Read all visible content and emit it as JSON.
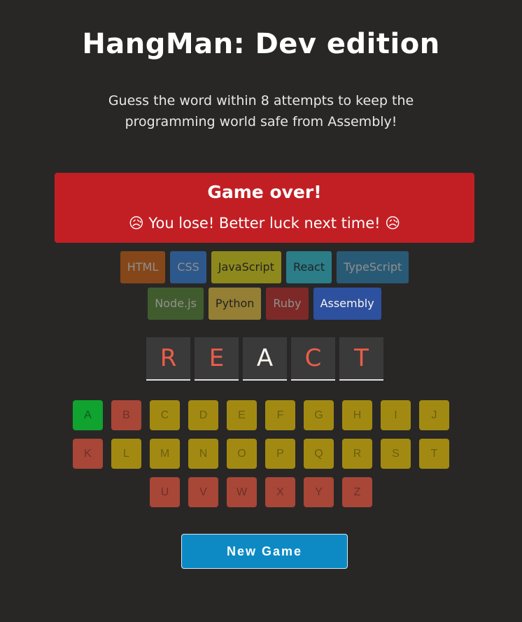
{
  "header": {
    "title": "HangMan: Dev edition",
    "subtitle": "Guess the word within 8 attempts to keep the programming world safe from Assembly!"
  },
  "status": {
    "title": "Game over!",
    "message": "😥 You lose! Better luck next time! 😥",
    "color": "#c21f24"
  },
  "languages": [
    {
      "name": "HTML",
      "bg": "#e2680f",
      "fg": "#f9f4ef",
      "lost": true
    },
    {
      "name": "CSS",
      "bg": "#328af1",
      "fg": "#f9f4ef",
      "lost": true
    },
    {
      "name": "JavaScript",
      "bg": "#f4eb13",
      "fg": "#1e1e1e",
      "lost": true
    },
    {
      "name": "React",
      "bg": "#2ed3e9",
      "fg": "#1e1e1e",
      "lost": true
    },
    {
      "name": "TypeScript",
      "bg": "#298ec6",
      "fg": "#f9f4ef",
      "lost": true
    },
    {
      "name": "Node.js",
      "bg": "#599137",
      "fg": "#f9f4ef",
      "lost": true
    },
    {
      "name": "Python",
      "bg": "#ffd742",
      "fg": "#1e1e1e",
      "lost": true
    },
    {
      "name": "Ruby",
      "bg": "#d02b2b",
      "fg": "#f9f4ef",
      "lost": true
    },
    {
      "name": "Assembly",
      "bg": "#2d519f",
      "fg": "#f9f4ef",
      "lost": false
    }
  ],
  "word": [
    {
      "letter": "R",
      "color": "#ec5d49"
    },
    {
      "letter": "E",
      "color": "#ec5d49"
    },
    {
      "letter": "A",
      "color": "#f9f4ef"
    },
    {
      "letter": "C",
      "color": "#ec5d49"
    },
    {
      "letter": "T",
      "color": "#ec5d49"
    }
  ],
  "keyboard": {
    "rows": [
      [
        {
          "letter": "A",
          "state": "correct"
        },
        {
          "letter": "B",
          "state": "wrong"
        },
        {
          "letter": "C",
          "state": "unused"
        },
        {
          "letter": "D",
          "state": "unused"
        },
        {
          "letter": "E",
          "state": "unused"
        },
        {
          "letter": "F",
          "state": "unused"
        },
        {
          "letter": "G",
          "state": "unused"
        },
        {
          "letter": "H",
          "state": "unused"
        },
        {
          "letter": "I",
          "state": "unused"
        },
        {
          "letter": "J",
          "state": "unused"
        }
      ],
      [
        {
          "letter": "K",
          "state": "wrong"
        },
        {
          "letter": "L",
          "state": "unused"
        },
        {
          "letter": "M",
          "state": "unused"
        },
        {
          "letter": "N",
          "state": "unused"
        },
        {
          "letter": "O",
          "state": "unused"
        },
        {
          "letter": "P",
          "state": "unused"
        },
        {
          "letter": "Q",
          "state": "unused"
        },
        {
          "letter": "R",
          "state": "unused"
        },
        {
          "letter": "S",
          "state": "unused"
        },
        {
          "letter": "T",
          "state": "unused"
        }
      ],
      [
        {
          "letter": "U",
          "state": "wrong"
        },
        {
          "letter": "V",
          "state": "wrong"
        },
        {
          "letter": "W",
          "state": "wrong"
        },
        {
          "letter": "X",
          "state": "wrong"
        },
        {
          "letter": "Y",
          "state": "wrong"
        },
        {
          "letter": "Z",
          "state": "wrong"
        }
      ]
    ]
  },
  "actions": {
    "new_game_label": "New Game"
  },
  "colors": {
    "background": "#282726",
    "correct": "#10a32f",
    "wrong": "#a84637",
    "unused": "#a28a12",
    "button": "#0d8ac4"
  }
}
